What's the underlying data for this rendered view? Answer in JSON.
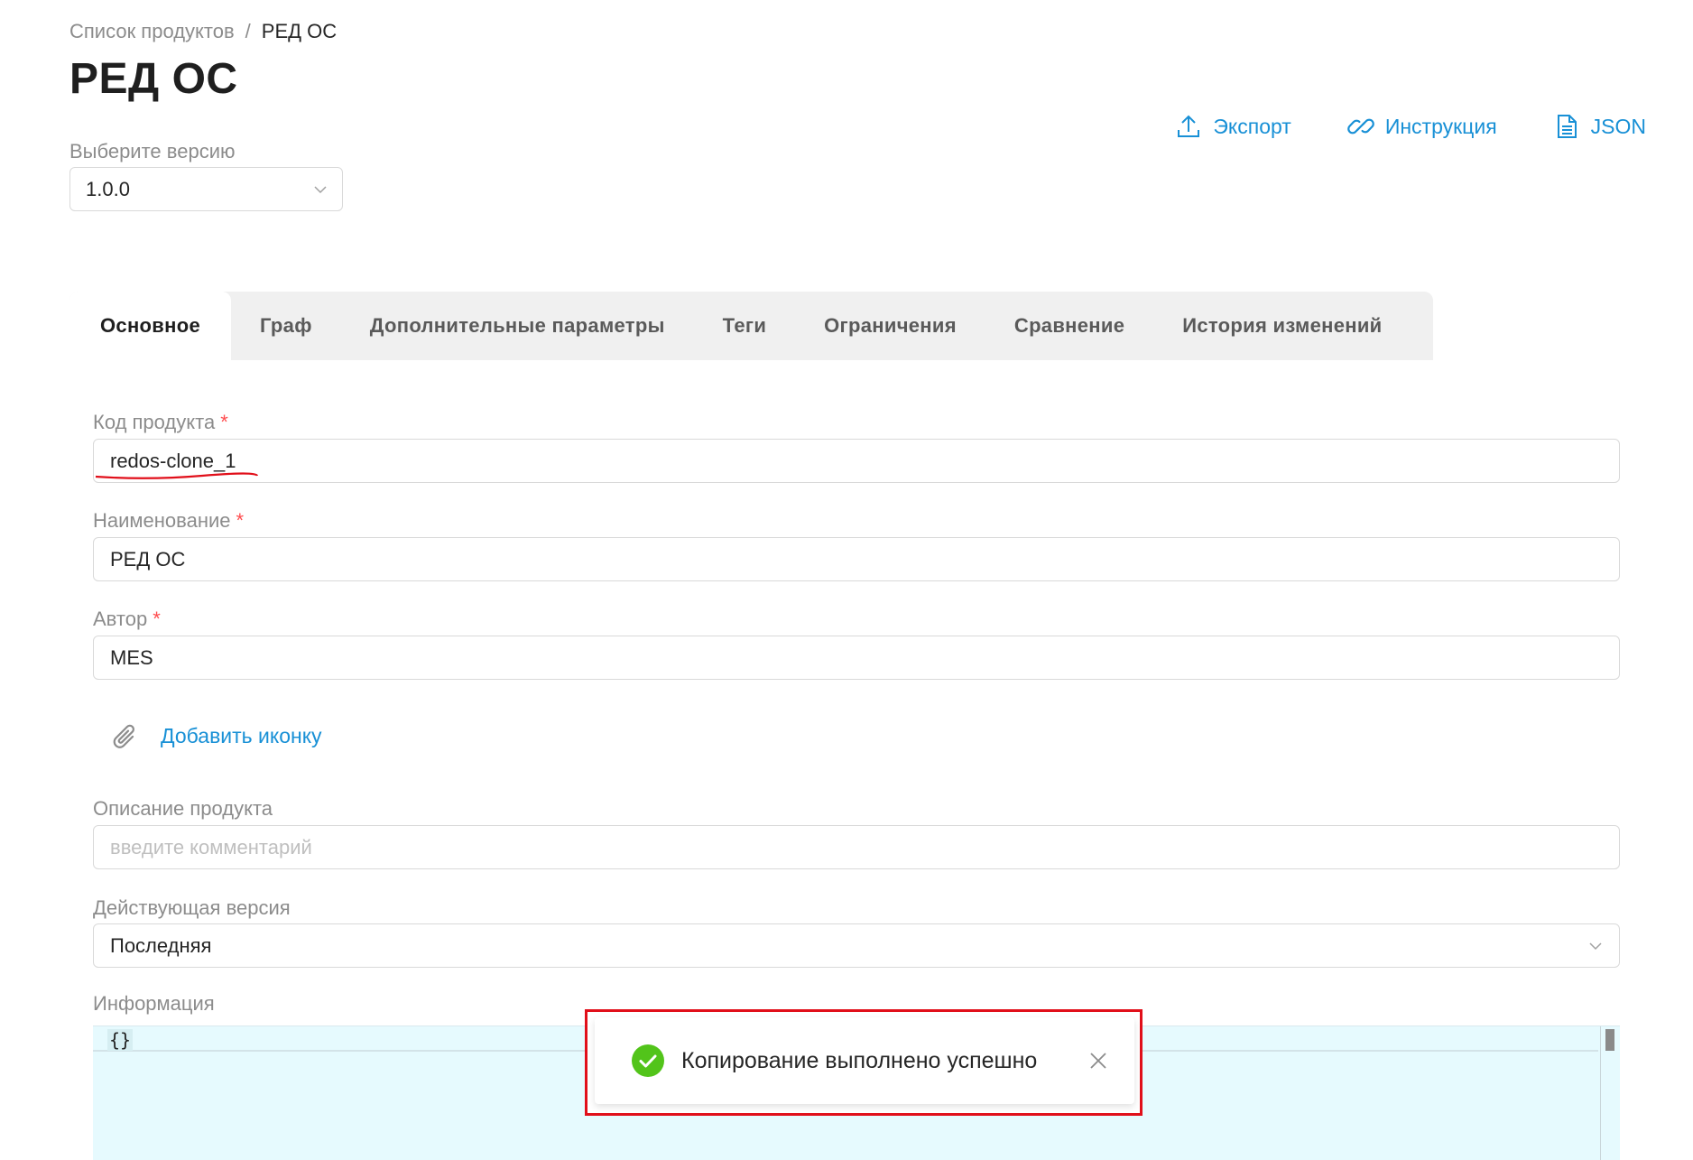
{
  "breadcrumb": {
    "parent": "Список продуктов",
    "separator": "/",
    "current": "РЕД ОС"
  },
  "page_title": "РЕД ОС",
  "version": {
    "label": "Выберите версию",
    "selected": "1.0.0"
  },
  "actions": {
    "export": "Экспорт",
    "instruction": "Инструкция",
    "json": "JSON"
  },
  "tabs": [
    {
      "label": "Основное",
      "active": true
    },
    {
      "label": "Граф"
    },
    {
      "label": "Дополнительные параметры"
    },
    {
      "label": "Теги"
    },
    {
      "label": "Ограничения"
    },
    {
      "label": "Сравнение"
    },
    {
      "label": "История изменений"
    }
  ],
  "form": {
    "product_code": {
      "label": "Код продукта",
      "required": "*",
      "value": "redos-clone_1"
    },
    "name": {
      "label": "Наименование",
      "required": "*",
      "value": "РЕД ОС"
    },
    "author": {
      "label": "Автор",
      "required": "*",
      "value": "MES"
    },
    "add_icon": "Добавить иконку",
    "description": {
      "label": "Описание продукта",
      "placeholder": "введите комментарий"
    },
    "active_version": {
      "label": "Действующая версия",
      "value": "Последняя"
    },
    "info": {
      "label": "Информация",
      "code": "{}"
    }
  },
  "toast": {
    "message": "Копирование выполнено успешно"
  },
  "colors": {
    "accent": "#1890d6",
    "required": "#ff4d4f",
    "success": "#52c41a",
    "highlight": "#e10f1a"
  }
}
